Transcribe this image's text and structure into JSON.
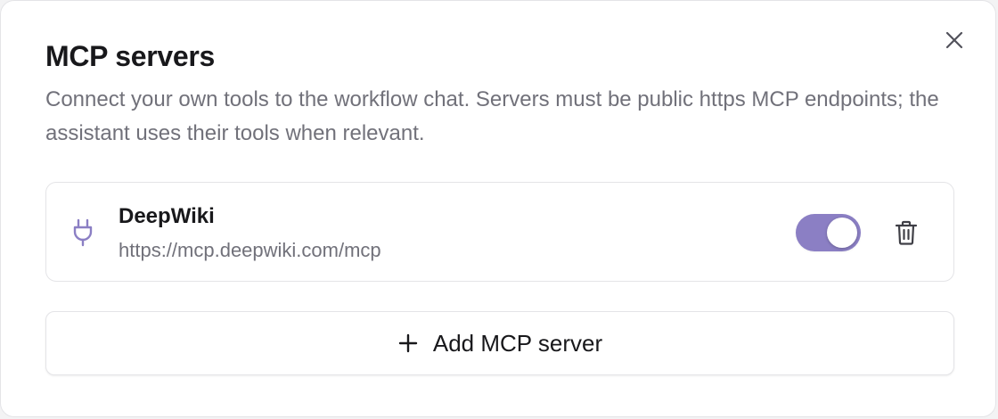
{
  "dialog": {
    "title": "MCP servers",
    "description": "Connect your own tools to the workflow chat. Servers must be public https MCP endpoints; the assistant uses their tools when relevant."
  },
  "servers": [
    {
      "name": "DeepWiki",
      "url": "https://mcp.deepwiki.com/mcp",
      "enabled": true,
      "icon": "plug-icon"
    }
  ],
  "actions": {
    "add_label": "Add MCP server",
    "add_icon": "plus-icon",
    "close_icon": "close-icon",
    "delete_icon": "trash-icon"
  },
  "colors": {
    "accent": "#8b7fc4",
    "text_primary": "#18181b",
    "text_muted": "#71717a",
    "border": "#e4e4e7"
  }
}
